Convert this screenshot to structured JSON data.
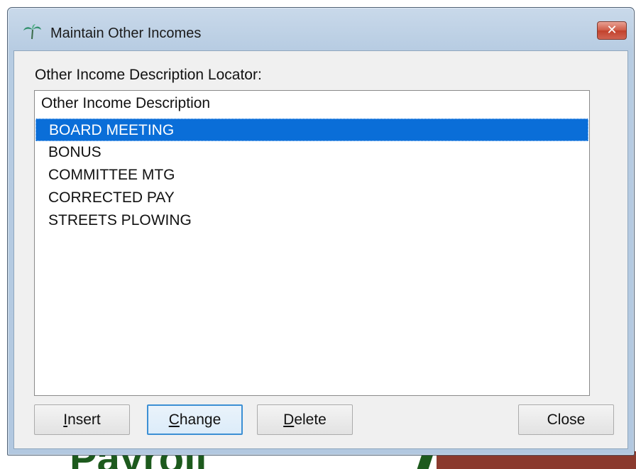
{
  "window": {
    "title": "Maintain Other Incomes",
    "close_glyph": "✕"
  },
  "icons": {
    "app": "palm-tree-icon",
    "close": "close-icon"
  },
  "locator": {
    "label": "Other Income Description Locator:"
  },
  "list": {
    "header": "Other Income Description",
    "items": [
      "BOARD MEETING",
      "BONUS",
      "COMMITTEE MTG",
      "CORRECTED PAY",
      "STREETS PLOWING"
    ],
    "selected": "BOARD MEETING"
  },
  "buttons": {
    "insert": {
      "mnemonic": "I",
      "rest": "nsert"
    },
    "change": {
      "mnemonic": "C",
      "rest": "hange"
    },
    "delete": {
      "mnemonic": "D",
      "rest": "elete"
    },
    "close": "Close"
  },
  "background": {
    "app_text": "Payroll"
  },
  "colors": {
    "selection": "#0a6ed8",
    "close_button": "#c2412c"
  }
}
